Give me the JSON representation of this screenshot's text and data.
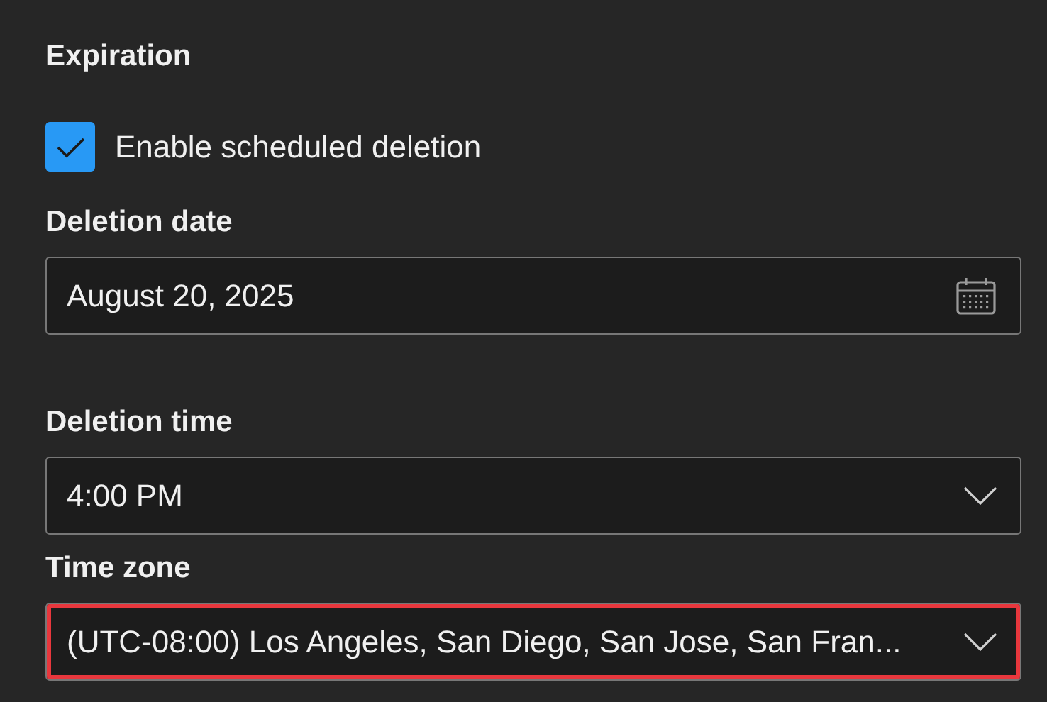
{
  "section": {
    "title": "Expiration"
  },
  "checkbox": {
    "label": "Enable scheduled deletion",
    "checked": true
  },
  "fields": [
    {
      "kind": "date",
      "label": "Deletion date",
      "value": "August 20, 2025",
      "highlighted": false
    },
    {
      "kind": "dropdown",
      "label": "Deletion time",
      "value": "4:00 PM",
      "highlighted": false
    },
    {
      "kind": "dropdown",
      "label": "Time zone",
      "value": "(UTC-08:00) Los Angeles, San Diego, San Jose, San Fran...",
      "highlighted": true
    }
  ]
}
